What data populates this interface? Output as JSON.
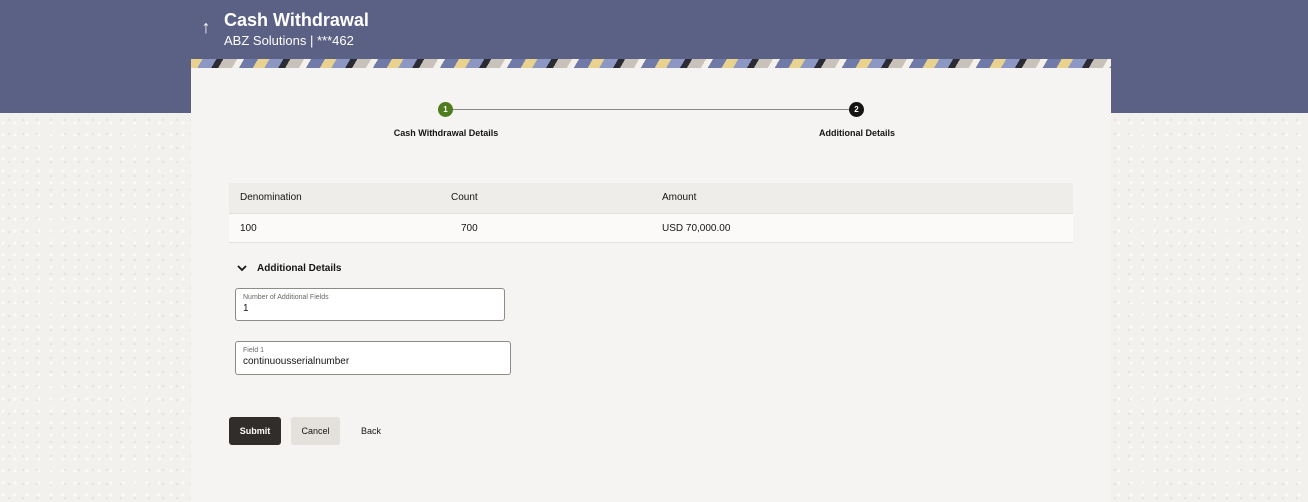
{
  "header": {
    "back_icon": "arrow-up-icon",
    "title": "Cash Withdrawal",
    "subtitle": "ABZ Solutions | ***462"
  },
  "stepper": {
    "steps": [
      {
        "number": "1",
        "label": "Cash Withdrawal Details",
        "status": "completed"
      },
      {
        "number": "2",
        "label": "Additional Details",
        "status": "current"
      }
    ],
    "completed_color": "#4e7c1f",
    "current_color": "#161513"
  },
  "table": {
    "columns": [
      "Denomination",
      "Count",
      "Amount"
    ],
    "rows": [
      {
        "denomination": "100",
        "count": "700",
        "amount": "USD 70,000.00"
      }
    ]
  },
  "additional_details": {
    "section_title": "Additional Details",
    "expanded": true,
    "number_of_fields": {
      "label": "Number of Additional Fields",
      "value": "1"
    },
    "field1": {
      "label": "Field 1",
      "value": "continuousserialnumber"
    }
  },
  "actions": {
    "submit_label": "Submit",
    "cancel_label": "Cancel",
    "back_label": "Back"
  },
  "colors": {
    "header_background": "#5b6185",
    "primary_button": "#312d2a"
  }
}
